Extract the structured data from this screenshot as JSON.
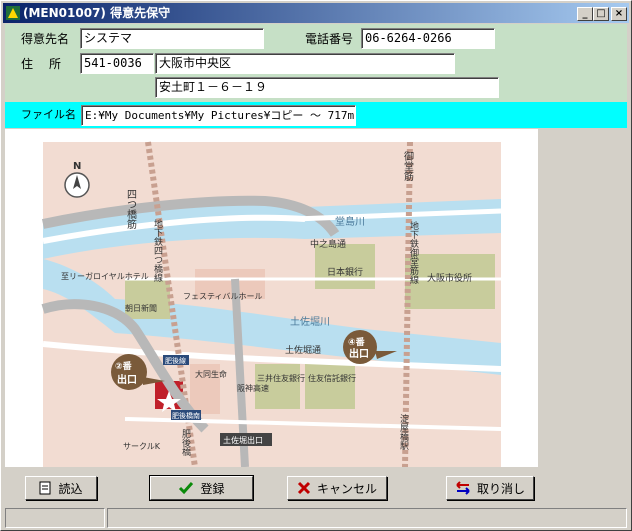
{
  "window": {
    "title": "(MEN01007) 得意先保守"
  },
  "form": {
    "customer_label": "得意先名",
    "customer_value": "システマ",
    "phone_label": "電話番号",
    "phone_value": "06-6264-0266",
    "address_label": "住　所",
    "zip_value": "541-0036",
    "address1_value": "大阪市中央区",
    "address2_value": "安土町１－６－１９"
  },
  "file": {
    "label": "ファイル名",
    "value": "E:¥My Documents¥My Pictures¥コピー ～ 717m."
  },
  "map": {
    "north": "N",
    "labels": {
      "yotsubashi_suji": "四つ橋筋",
      "midosuji": "御堂筋",
      "dojima_river": "堂島川",
      "nakanoshima": "中之島通",
      "boj": "日本銀行",
      "osaka_city_hall": "大阪市役所",
      "royal_hotel": "至リーガロイヤルホテル",
      "festival_hall": "フェスティバルホール",
      "asahi": "朝日新聞",
      "subway_yotsubashi": "地下鉄四つ橋線",
      "subway_midosuji": "地下鉄御堂筋線",
      "tosabori_river": "土佐堀川",
      "tosabori_dori": "土佐堀通",
      "exit4_num": "④番",
      "exit4_txt": "出口",
      "exit2_num": "②番",
      "exit2_txt": "出口",
      "higobashi_line": "肥後線",
      "daido": "大同生命",
      "sumitomo_bank": "三井住友銀行",
      "sumitomo_trust": "住友信託銀行",
      "hanshin": "阪神高速",
      "higobashi_sta": "肥後橋南",
      "higobashi": "肥後橋",
      "circle_k": "サークルK",
      "tosabori_exit": "土佐堀出口",
      "yodoyabashi": "淀屋橋駅"
    }
  },
  "buttons": {
    "read": "読込",
    "register": "登録",
    "cancel": "キャンセル",
    "undo": "取り消し"
  },
  "colors": {
    "form_bg": "#c6e0c6",
    "file_band": "#00ffff",
    "map_land": "#f2dcd2",
    "map_water": "#b9dff0",
    "map_road": "#ffffff",
    "map_block": "#ecc9bb",
    "map_green": "#c8cc9c",
    "exit_marker": "#7a5a3a"
  }
}
